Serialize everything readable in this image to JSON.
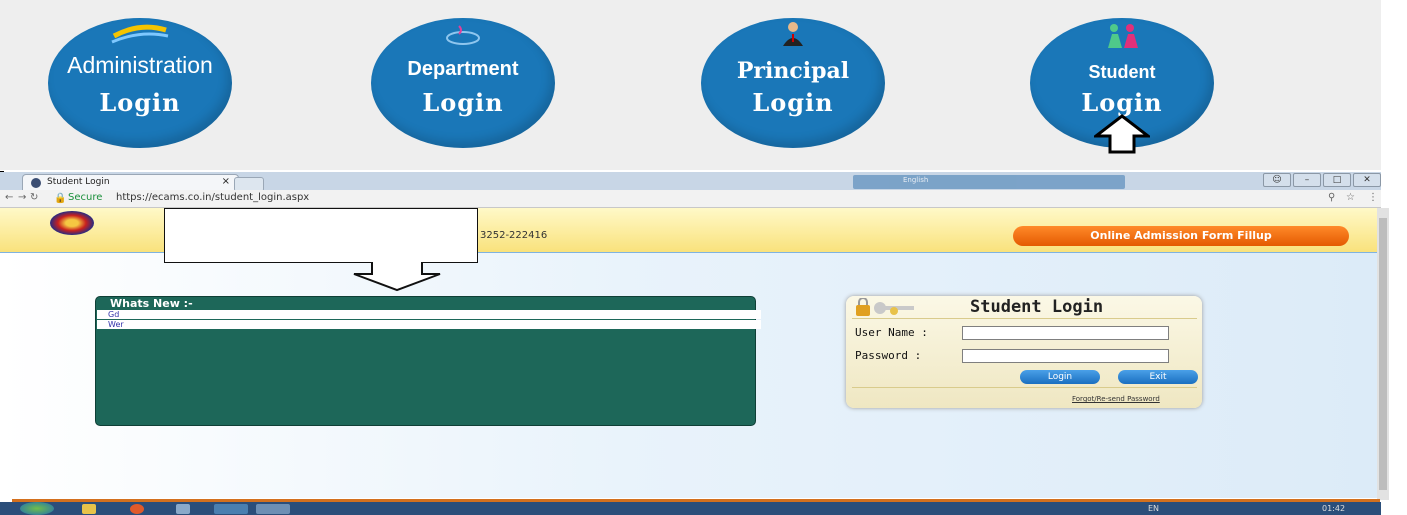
{
  "banner": {
    "admin": {
      "line1": "Administration",
      "line2": "Login"
    },
    "department": {
      "line1": "Department",
      "line2": "Login"
    },
    "principal": {
      "line1": "Principal",
      "line2": "Login"
    },
    "student": {
      "line1": "Student",
      "line2": "Login"
    }
  },
  "browser": {
    "tab_title": "Student Login",
    "tab_close": "×",
    "secure_label": "Secure",
    "url": "https://ecams.co.in/student_login.aspx",
    "language": "English"
  },
  "page": {
    "phone_partial": "3252-222416",
    "admission_button": "Online Admission Form Fillup",
    "whats_new": {
      "title": "Whats New :-",
      "items": [
        "Gd",
        "Wer"
      ]
    },
    "login": {
      "title": "Student Login",
      "username_label": "User Name :",
      "password_label": "Password :",
      "login_button": "Login",
      "exit_button": "Exit",
      "forgot_link": "Forgot/Re-send Password"
    }
  },
  "taskbar": {
    "lang": "EN",
    "clock": "01:42"
  },
  "colors": {
    "circle_blue": "#1a77b8",
    "panel_green": "#1d6759",
    "orange": "#e45a00"
  }
}
